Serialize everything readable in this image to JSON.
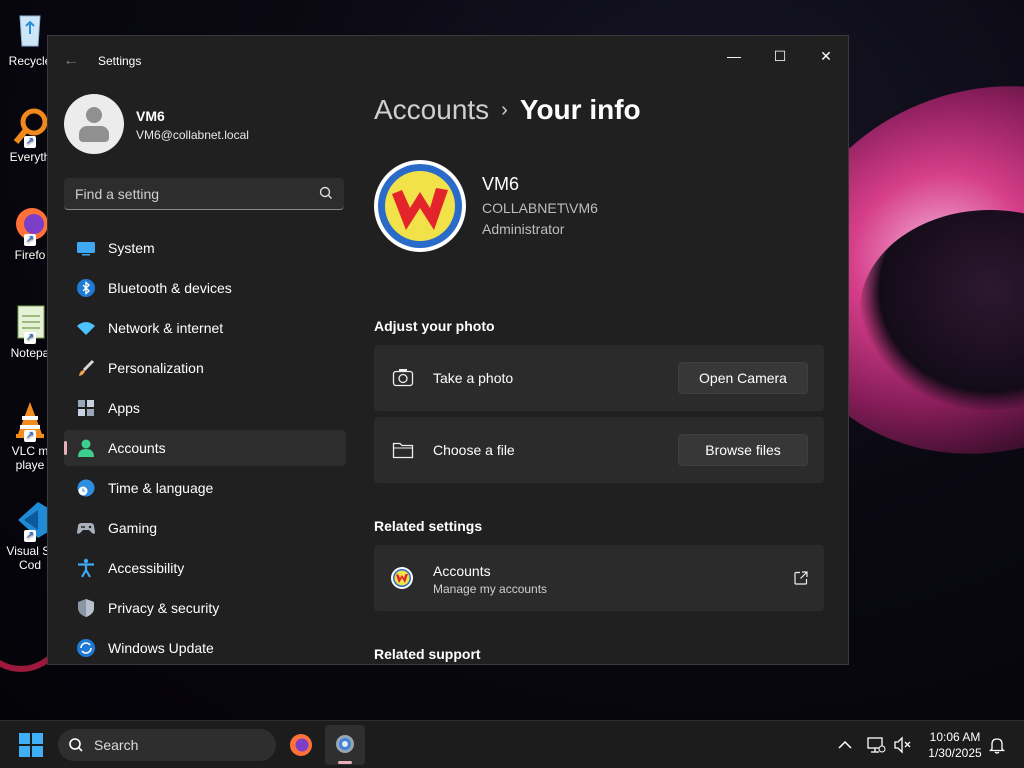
{
  "desktop": {
    "icons": [
      {
        "label": "Recycle"
      },
      {
        "label": "Everyth"
      },
      {
        "label": "Firefo"
      },
      {
        "label": "Notepa"
      },
      {
        "label": "VLC m",
        "label2": "playe"
      },
      {
        "label": "Visual St",
        "label2": "Cod"
      }
    ]
  },
  "window": {
    "title": "Settings",
    "controls": {
      "minimize": "—",
      "maximize": "☐",
      "close": "✕"
    }
  },
  "sidebar": {
    "profile": {
      "name": "VM6",
      "email": "VM6@collabnet.local"
    },
    "search": {
      "placeholder": "Find a setting"
    },
    "items": [
      {
        "label": "System",
        "icon": "system-icon"
      },
      {
        "label": "Bluetooth & devices",
        "icon": "bluetooth-icon"
      },
      {
        "label": "Network & internet",
        "icon": "wifi-icon"
      },
      {
        "label": "Personalization",
        "icon": "brush-icon"
      },
      {
        "label": "Apps",
        "icon": "apps-icon"
      },
      {
        "label": "Accounts",
        "icon": "accounts-icon",
        "active": true
      },
      {
        "label": "Time & language",
        "icon": "globe-clock-icon"
      },
      {
        "label": "Gaming",
        "icon": "gamepad-icon"
      },
      {
        "label": "Accessibility",
        "icon": "accessibility-icon"
      },
      {
        "label": "Privacy & security",
        "icon": "shield-icon"
      },
      {
        "label": "Windows Update",
        "icon": "update-icon"
      }
    ],
    "accent_color": "#e8b0b8"
  },
  "content": {
    "breadcrumb": {
      "parent": "Accounts",
      "separator": "›",
      "current": "Your info"
    },
    "user": {
      "name": "VM6",
      "domain": "COLLABNET\\VM6",
      "role": "Administrator"
    },
    "adjust_photo": {
      "heading": "Adjust your photo",
      "take_photo": {
        "label": "Take a photo",
        "button": "Open Camera"
      },
      "choose_file": {
        "label": "Choose a file",
        "button": "Browse files"
      }
    },
    "related_settings": {
      "heading": "Related settings",
      "accounts": {
        "title": "Accounts",
        "subtitle": "Manage my accounts"
      }
    },
    "related_support": {
      "heading": "Related support"
    }
  },
  "taskbar": {
    "search_label": "Search",
    "time": "10:06 AM",
    "date": "1/30/2025"
  }
}
